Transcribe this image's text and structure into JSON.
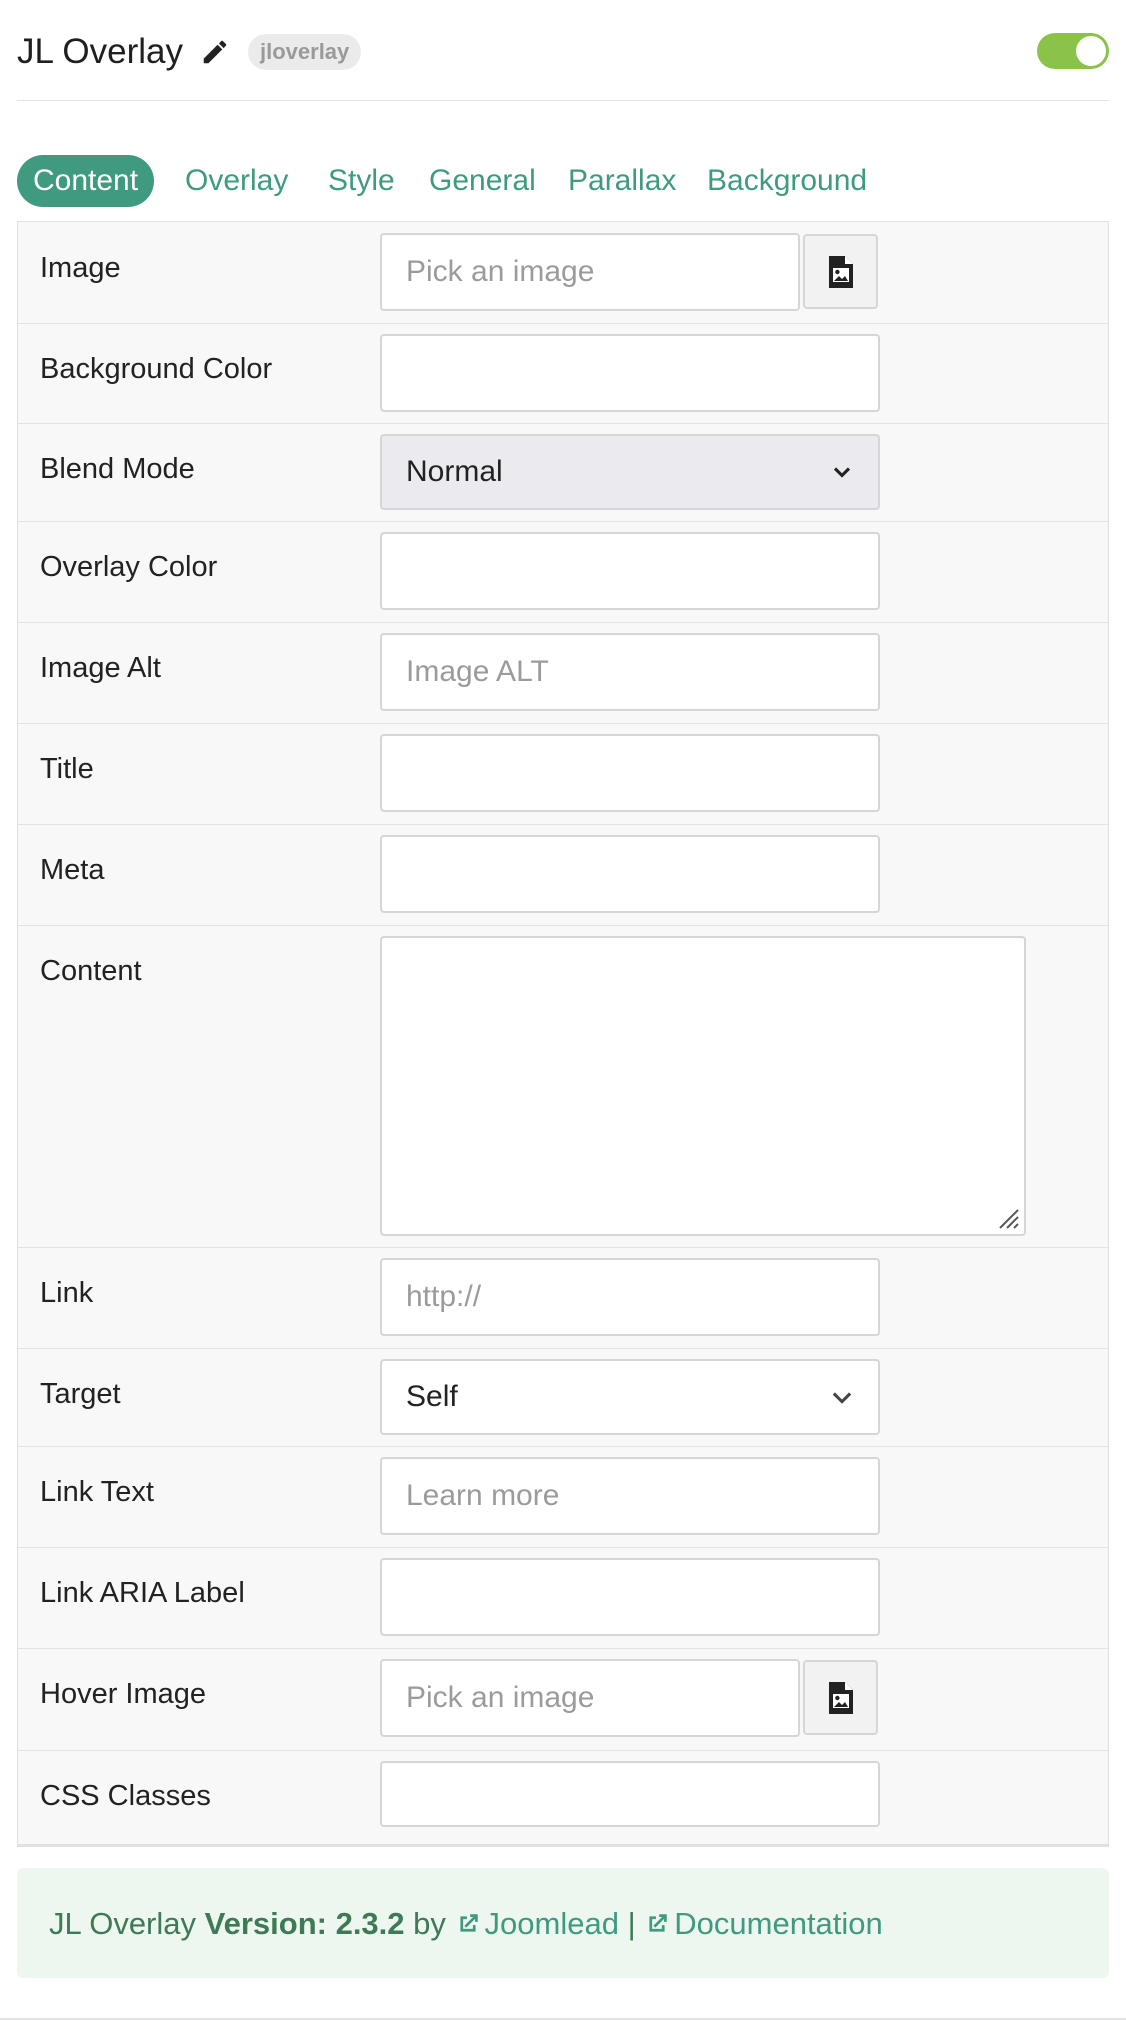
{
  "header": {
    "title": "JL Overlay",
    "badge": "jloverlay",
    "enabled": true
  },
  "tabs": [
    {
      "label": "Content",
      "active": true
    },
    {
      "label": "Overlay",
      "active": false
    },
    {
      "label": "Style",
      "active": false
    },
    {
      "label": "General",
      "active": false
    },
    {
      "label": "Parallax",
      "active": false
    },
    {
      "label": "Background",
      "active": false
    }
  ],
  "fields": {
    "image": {
      "label": "Image",
      "value": "",
      "placeholder": "Pick an image"
    },
    "background_color": {
      "label": "Background Color",
      "value": "",
      "placeholder": ""
    },
    "blend_mode": {
      "label": "Blend Mode",
      "selected": "Normal"
    },
    "overlay_color": {
      "label": "Overlay Color",
      "value": "",
      "placeholder": ""
    },
    "image_alt": {
      "label": "Image Alt",
      "value": "",
      "placeholder": "Image ALT"
    },
    "title": {
      "label": "Title",
      "value": "",
      "placeholder": ""
    },
    "meta": {
      "label": "Meta",
      "value": "",
      "placeholder": ""
    },
    "content": {
      "label": "Content",
      "value": ""
    },
    "link": {
      "label": "Link",
      "value": "",
      "placeholder": "http://"
    },
    "target": {
      "label": "Target",
      "selected": "Self"
    },
    "link_text": {
      "label": "Link Text",
      "value": "",
      "placeholder": "Learn more"
    },
    "link_aria_label": {
      "label": "Link ARIA Label",
      "value": "",
      "placeholder": ""
    },
    "hover_image": {
      "label": "Hover Image",
      "value": "",
      "placeholder": "Pick an image"
    },
    "css_classes": {
      "label": "CSS Classes",
      "value": "",
      "placeholder": ""
    }
  },
  "footer": {
    "product": "JL Overlay",
    "version_label": "Version: 2.3.2",
    "by": "by",
    "author_link": "Joomlead",
    "separator": "|",
    "docs_link": "Documentation"
  },
  "colors": {
    "accent": "#3f9a80",
    "toggle_on": "#8bc34a",
    "footer_bg": "#eef6f0",
    "footer_text": "#3e7a55"
  },
  "icons": {
    "edit": "pencil-icon",
    "browse": "image-file-icon",
    "dropdown": "chevron-down-icon",
    "external": "external-link-icon",
    "resize": "resize-handle-icon"
  }
}
